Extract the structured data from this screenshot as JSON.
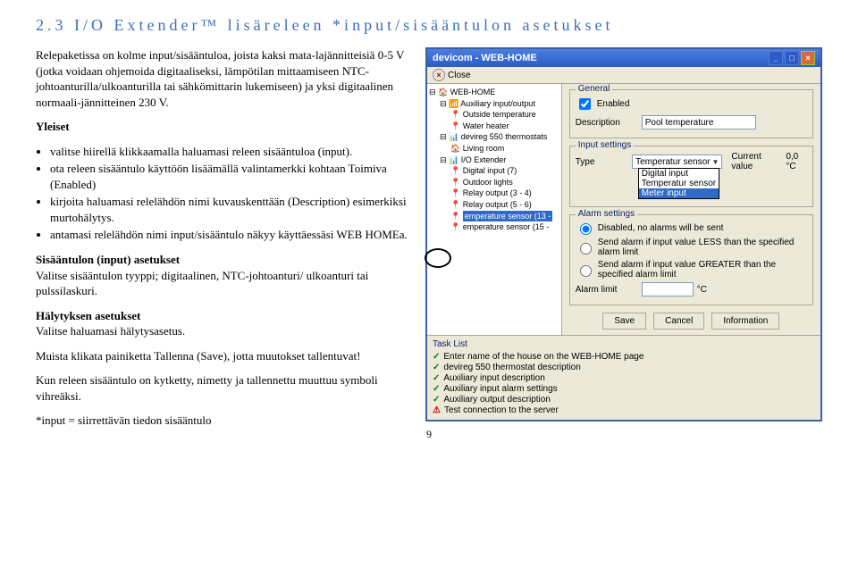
{
  "heading": "2.3 I/O Extender™ lisäreleen *input/sisääntulon asetukset",
  "left": {
    "intro": "Relepaketissa on kolme input/sisääntuloa, joista kaksi mata-lajännitteisiä 0-5 V (jotka voidaan ohjemoida digitaaliseksi, lämpötilan mittaamiseen NTC-johtoanturilla/ulkoanturilla tai sähkömittarin lukemiseen) ja yksi digitaalinen normaali-jännitteinen 230 V.",
    "yleiset": "Yleiset",
    "bullets1": [
      "valitse hiirellä klikkaamalla haluamasi releen sisääntuloa (input).",
      "ota releen sisääntulo käyttöön lisäämällä valintamerkki kohtaan Toimiva (Enabled)",
      "kirjoita haluamasi relelähdön nimi kuvauskenttään (Description) esimerkiksi murtohälytys.",
      "antamasi relelähdön nimi input/sisääntulo näkyy käyttäessäsi WEB HOMEa."
    ],
    "sub1t": "Sisääntulon (input) asetukset",
    "sub1b": "Valitse sisääntulon tyyppi; digitaalinen, NTC-johtoanturi/ ulkoanturi tai pulssilaskuri.",
    "sub2t": "Hälytyksen asetukset",
    "sub2b": "Valitse haluamasi hälytysasetus.",
    "note1": "Muista klikata painiketta Tallenna (Save), jotta muutokset tallentuvat!",
    "note2": "Kun releen sisääntulo on kytketty, nimetty ja tallennettu muuttuu symboli vihreäksi.",
    "footnote": "*input = siirrettävän tiedon sisääntulo"
  },
  "dialog": {
    "title": "devicom - WEB-HOME",
    "close": "Close",
    "tree": {
      "root": "WEB-HOME",
      "items": [
        "Auxiliary input/output",
        "Outside temperature",
        "Water heater",
        "devireg 550 thermostats",
        "Living room",
        "I/O Extender",
        "Digital input (7)",
        "Outdoor lights",
        "Relay output (3 - 4)",
        "Relay output (5 - 6)",
        "emperature sensor (13 -",
        "emperature sensor (15 -"
      ]
    },
    "general": {
      "legend": "General",
      "enabled": "Enabled",
      "descLabel": "Description",
      "descValue": "Pool temperature"
    },
    "input": {
      "legend": "Input settings",
      "typeLabel": "Type",
      "typeValue": "Temperatur sensor",
      "options": [
        "Digital input",
        "Temperatur sensor",
        "Meter input"
      ],
      "curLabel": "Current value",
      "curValue": "0,0 °C"
    },
    "alarm": {
      "legend": "Alarm settings",
      "opt1": "Disabled, no alarms will be sent",
      "opt2": "Send alarm if input value LESS than the specified alarm limit",
      "opt3": "Send alarm if input value GREATER than the specified alarm limit",
      "limitLabel": "Alarm limit",
      "limitUnit": "°C"
    },
    "buttons": {
      "save": "Save",
      "cancel": "Cancel",
      "info": "Information"
    },
    "tasks": {
      "title": "Task List",
      "items": [
        {
          "icon": "check",
          "text": "Enter name of the house on the WEB-HOME page"
        },
        {
          "icon": "check",
          "text": "devireg 550 thermostat description"
        },
        {
          "icon": "check",
          "text": "Auxiliary input description"
        },
        {
          "icon": "check",
          "text": "Auxiliary input alarm settings"
        },
        {
          "icon": "check",
          "text": "Auxiliary output description"
        },
        {
          "icon": "warn",
          "text": "Test connection to the server"
        }
      ]
    }
  },
  "pagenum": "9"
}
